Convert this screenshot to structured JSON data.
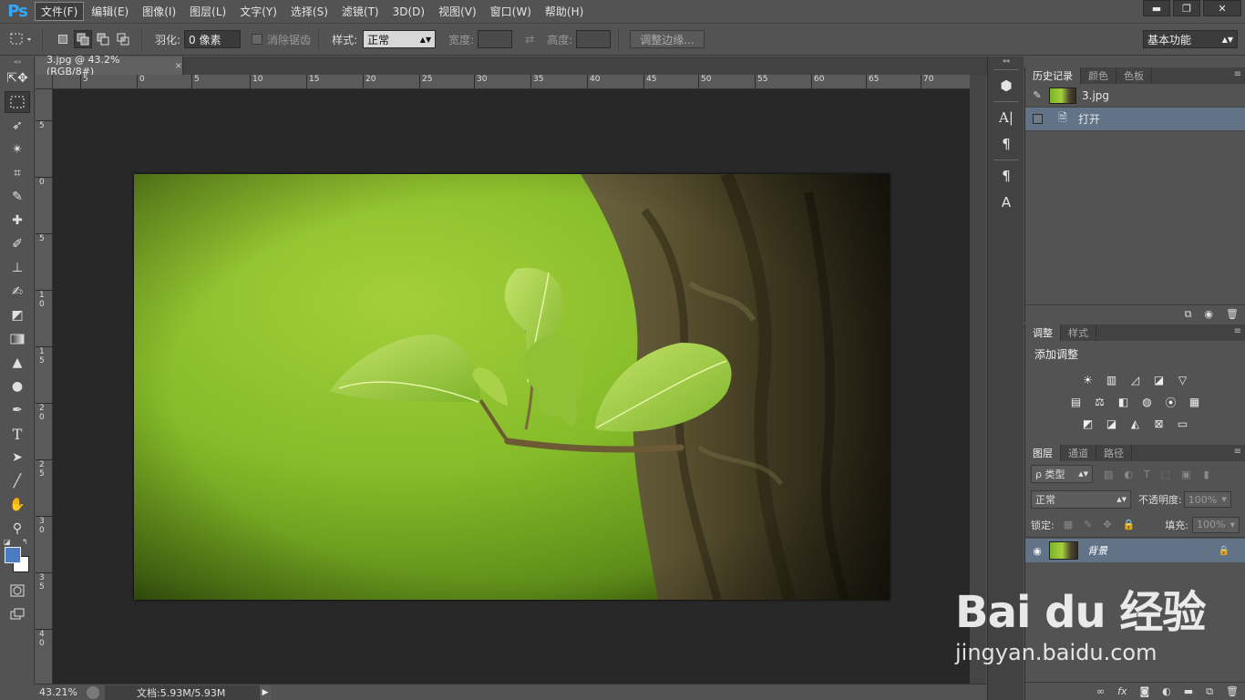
{
  "app": {
    "logo": "Ps"
  },
  "menu": {
    "items": [
      "文件(F)",
      "编辑(E)",
      "图像(I)",
      "图层(L)",
      "文字(Y)",
      "选择(S)",
      "滤镜(T)",
      "3D(D)",
      "视图(V)",
      "窗口(W)",
      "帮助(H)"
    ],
    "active_index": 0
  },
  "window_controls": {
    "minimize": "▬",
    "restore": "❐",
    "close": "✕"
  },
  "options": {
    "feather_label": "羽化:",
    "feather_value": "0 像素",
    "antialias_label": "消除锯齿",
    "style_label": "样式:",
    "style_value": "正常",
    "width_label": "宽度:",
    "height_label": "高度:",
    "refine_edge": "调整边缘...",
    "workspace": "基本功能"
  },
  "document": {
    "tab_title": "3.jpg @ 43.2%(RGB/8#)",
    "tab_close": "×",
    "zoom": "43.21%",
    "doc_info": "文档:5.93M/5.93M",
    "ruler_h": [
      "5",
      "0",
      "5",
      "10",
      "15",
      "20",
      "25",
      "30",
      "35",
      "40",
      "45",
      "50",
      "55",
      "60",
      "65",
      "70"
    ],
    "ruler_v": [
      "5",
      "0",
      "5",
      "1 0",
      "1 5",
      "2 0",
      "2 5",
      "3 0",
      "3 5",
      "4 0"
    ]
  },
  "history_panel": {
    "tabs": [
      "历史记录",
      "颜色",
      "色板"
    ],
    "snapshot": "3.jpg",
    "steps": [
      "打开"
    ]
  },
  "adjust_panel": {
    "tabs": [
      "调整",
      "样式"
    ],
    "title": "添加调整"
  },
  "layers_panel": {
    "tabs": [
      "图层",
      "通道",
      "路径"
    ],
    "filter_label": "ρ 类型",
    "blend_mode": "正常",
    "opacity_label": "不透明度:",
    "opacity_value": "100%",
    "lock_label": "锁定:",
    "fill_label": "填充:",
    "fill_value": "100%",
    "layers": [
      {
        "name": "背景",
        "visible": true,
        "locked": true
      }
    ],
    "footer_icons": [
      "link-icon",
      "fx-icon",
      "mask-icon",
      "adjustment-icon",
      "folder-icon",
      "new-layer-icon",
      "trash-icon"
    ]
  },
  "watermark": {
    "logo": "Bai du 经验",
    "url": "jingyan.baidu.com"
  },
  "colors": {
    "foreground": "#4a7cc2",
    "background": "#ffffff",
    "selection": "#627287"
  }
}
